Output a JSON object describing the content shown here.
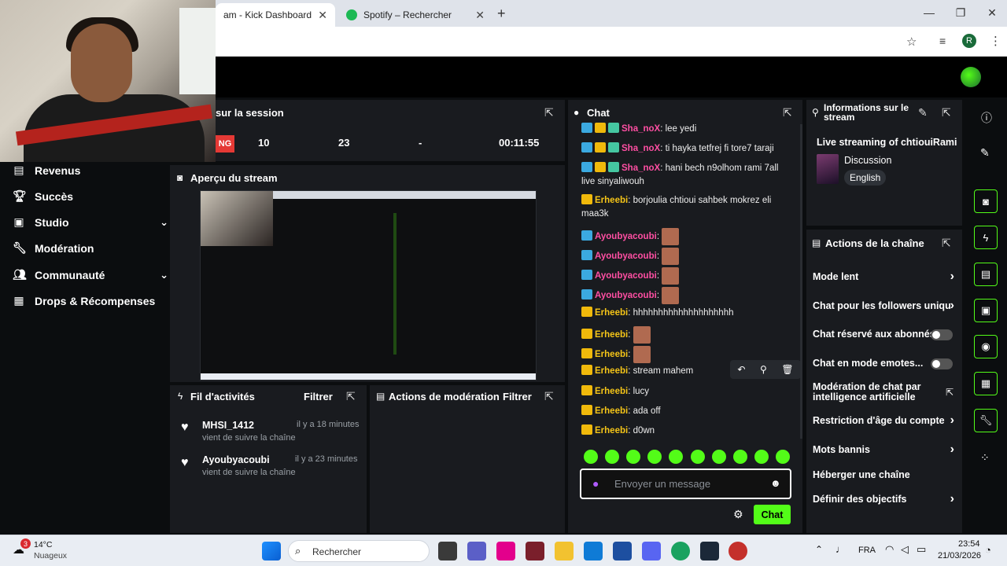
{
  "browser": {
    "tabs": [
      {
        "label": "am - Kick Dashboard",
        "active": true
      },
      {
        "label": "Spotify – Rechercher",
        "active": false
      }
    ],
    "avatar_letter": "R"
  },
  "sidebar": {
    "items": [
      {
        "label": "Revenus",
        "icon": "chart-icon"
      },
      {
        "label": "Succès",
        "icon": "trophy-icon"
      },
      {
        "label": "Studio",
        "icon": "studio-icon",
        "chevron": true
      },
      {
        "label": "Modération",
        "icon": "wrench-icon"
      },
      {
        "label": "Communauté",
        "icon": "people-icon",
        "chevron": true
      },
      {
        "label": "Drops & Récompenses",
        "icon": "gift-icon"
      }
    ]
  },
  "session": {
    "title": "sur la session",
    "live_badge": "NG",
    "stats": [
      "10",
      "23",
      "-",
      "00:11:55"
    ]
  },
  "preview": {
    "title": "Aperçu du stream"
  },
  "activity": {
    "title": "Fil d'activités",
    "filter": "Filtrer",
    "items": [
      {
        "user": "MHSI_1412",
        "time": "il y a 18 minutes",
        "desc": "vient de suivre la chaîne"
      },
      {
        "user": "Ayoubyacoubi",
        "time": "il y a 23 minutes",
        "desc": "vient de suivre la chaîne"
      }
    ]
  },
  "moderation_actions": {
    "title": "Actions de modération",
    "filter": "Filtrer"
  },
  "chat": {
    "title": "Chat",
    "messages": [
      {
        "user": "Sha_noX",
        "text": "lee yedi"
      },
      {
        "user": "Sha_noX",
        "text": "ti hayka tetfrej fi tore7 taraji"
      },
      {
        "user": "Sha_noX",
        "text": "hani bech n9olhom rami 7all live sinyaliwouh"
      },
      {
        "user": "Erheebi",
        "text": "borjoulia chtioui sahbek mokrez eli maa3k"
      },
      {
        "user": "Ayoubyacoubi",
        "text": ""
      },
      {
        "user": "Ayoubyacoubi",
        "text": ""
      },
      {
        "user": "Ayoubyacoubi",
        "text": ""
      },
      {
        "user": "Ayoubyacoubi",
        "text": ""
      },
      {
        "user": "Erheebi",
        "text": "hhhhhhhhhhhhhhhhhhhh"
      },
      {
        "user": "Erheebi",
        "text": ""
      },
      {
        "user": "Erheebi",
        "text": ""
      },
      {
        "user": "Erheebi",
        "text": "stream mahem"
      },
      {
        "user": "Erheebi",
        "text": "lucy"
      },
      {
        "user": "Erheebi",
        "text": "ada off"
      },
      {
        "user": "Erheebi",
        "text": "d0wn"
      }
    ],
    "input_placeholder": "Envoyer un message",
    "send_label": "Chat"
  },
  "info": {
    "title": "Informations sur le stream",
    "stream_title": "Live streaming of chtiouiRami",
    "category": "Discussion",
    "language": "English"
  },
  "channel_actions": {
    "title": "Actions de la chaîne",
    "items": [
      {
        "label": "Mode lent",
        "control": "arrow"
      },
      {
        "label": "Chat pour les followers uniqu",
        "control": "arrow"
      },
      {
        "label": "Chat réservé aux abonnés",
        "control": "toggle"
      },
      {
        "label": "Chat en mode emotes...",
        "control": "toggle"
      },
      {
        "label": "Modération de chat par intelligence artificielle",
        "control": "external"
      },
      {
        "label": "Restriction d'âge du compte",
        "control": "arrow"
      },
      {
        "label": "Mots bannis",
        "control": "arrow"
      },
      {
        "label": "Héberger une chaîne",
        "control": "none"
      },
      {
        "label": "Définir des objectifs",
        "control": "arrow"
      }
    ]
  },
  "taskbar": {
    "weather_temp": "14°C",
    "weather_desc": "Nuageux",
    "weather_badge": "3",
    "search_placeholder": "Rechercher",
    "lang": "FRA",
    "time": "23:54",
    "date": "21/03/2026"
  },
  "colors": {
    "accent": "#53fc18",
    "panel": "#191b1f",
    "pink": "#ff4fa3",
    "gold": "#f5c518"
  }
}
